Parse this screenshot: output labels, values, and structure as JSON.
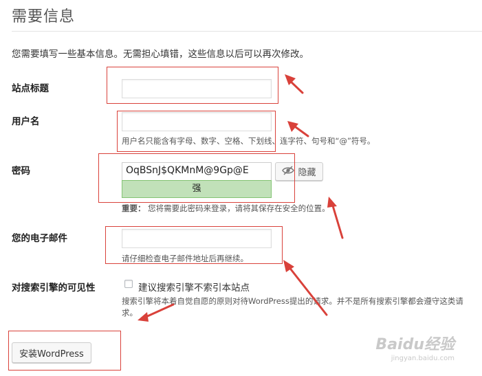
{
  "header": {
    "title": "需要信息"
  },
  "intro": "您需要填写一些基本信息。无需担心填错，这些信息以后可以再次修改。",
  "fields": {
    "site_title": {
      "label": "站点标题",
      "value": ""
    },
    "username": {
      "label": "用户名",
      "value": "",
      "hint": "用户名只能含有字母、数字、空格、下划线、连字符、句号和“@”符号。"
    },
    "password": {
      "label": "密码",
      "value": "OqBSnJ$QKMnM@9Gp@E",
      "strength": "强",
      "hide_label": "隐藏",
      "note_bold": "重要：",
      "note": "您将需要此密码来登录，请将其保存在安全的位置。"
    },
    "email": {
      "label": "您的电子邮件",
      "value": "",
      "hint": "请仔细检查电子邮件地址后再继续。"
    },
    "search_visibility": {
      "label": "对搜索引擎的可见性",
      "checkbox_label": "建议搜索引擎不索引本站点",
      "checked": false,
      "description": "搜索引擎将本着自觉自愿的原则对待WordPress提出的请求。并不是所有搜索引擎都会遵守这类请求。"
    }
  },
  "install_button": "安装WordPress",
  "watermark": {
    "main": "Baidu经验",
    "sub": "jingyan.baidu.com"
  },
  "colors": {
    "annotation": "#d9413a",
    "strength_bg": "#c1e1b9",
    "strength_border": "#83c373"
  }
}
